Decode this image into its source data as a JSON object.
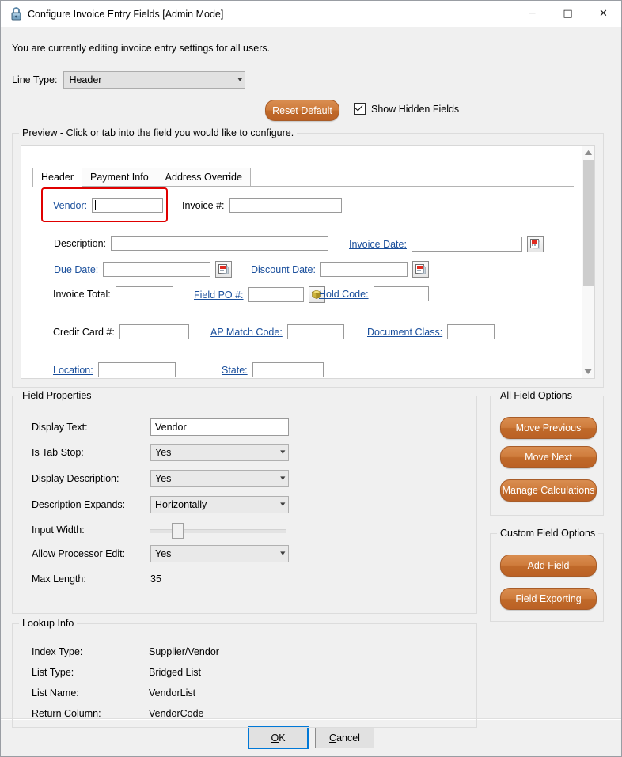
{
  "window": {
    "title": "Configure Invoice Entry Fields [Admin Mode]",
    "lock_icon": "lock-icon",
    "minimize": "─",
    "maximize": "□",
    "close": "✕"
  },
  "notice": "You are currently editing invoice entry settings for all users.",
  "toolbar": {
    "line_type_label": "Line Type:",
    "line_type_value": "Header",
    "reset_default_label": "Reset Default",
    "show_hidden_fields_label": "Show Hidden Fields",
    "show_hidden_fields_checked": true
  },
  "preview": {
    "legend": "Preview - Click or tab into the field you would like to configure.",
    "tabs": [
      {
        "label": "Header",
        "active": true
      },
      {
        "label": "Payment Info",
        "active": false
      },
      {
        "label": "Address Override",
        "active": false
      }
    ],
    "fields": [
      {
        "label": "Vendor:",
        "link": true,
        "selected": true
      },
      {
        "label": "Invoice #:",
        "link": false
      },
      {
        "label": "Description:",
        "link": false
      },
      {
        "label": "Invoice Date:",
        "link": true,
        "icon": "calendar-icon"
      },
      {
        "label": "Due Date:",
        "link": true,
        "icon": "calendar-icon"
      },
      {
        "label": "Discount Date:",
        "link": true,
        "icon": "calendar-icon"
      },
      {
        "label": "Invoice Total:",
        "link": false
      },
      {
        "label": "Field PO #:",
        "link": true,
        "icon": "cube-icon"
      },
      {
        "label": "Hold Code:",
        "link": true
      },
      {
        "label": "Credit Card #:",
        "link": false
      },
      {
        "label": "AP Match Code:",
        "link": true
      },
      {
        "label": "Document Class:",
        "link": true
      },
      {
        "label": "Location:",
        "link": true
      },
      {
        "label": "State:",
        "link": true
      }
    ]
  },
  "field_properties": {
    "legend": "Field Properties",
    "rows": [
      {
        "label": "Display Text:",
        "value": "Vendor",
        "type": "text"
      },
      {
        "label": "Is Tab Stop:",
        "value": "Yes",
        "type": "combo"
      },
      {
        "label": "Display Description:",
        "value": "Yes",
        "type": "combo"
      },
      {
        "label": "Description Expands:",
        "value": "Horizontally",
        "type": "combo"
      },
      {
        "label": "Input Width:",
        "value": "17",
        "type": "slider"
      },
      {
        "label": "Allow Processor Edit:",
        "value": "Yes",
        "type": "combo"
      },
      {
        "label": "Max Length:",
        "value": "35",
        "type": "static"
      }
    ]
  },
  "lookup_info": {
    "legend": "Lookup Info",
    "rows": [
      {
        "label": "Index Type:",
        "value": "Supplier/Vendor"
      },
      {
        "label": "List Type:",
        "value": "Bridged List"
      },
      {
        "label": "List Name:",
        "value": "VendorList"
      },
      {
        "label": "Return Column:",
        "value": "VendorCode"
      }
    ]
  },
  "all_field_options": {
    "legend": "All Field Options",
    "buttons": [
      "Move Previous",
      "Move Next",
      "Manage Calculations"
    ]
  },
  "custom_field_options": {
    "legend": "Custom Field Options",
    "buttons": [
      "Add Field",
      "Field Exporting"
    ]
  },
  "footer": {
    "ok_label": "OK",
    "cancel_label": "Cancel"
  },
  "colors": {
    "accent_orange": "#c06a2a",
    "link_blue": "#1a4f9c",
    "selection_red": "#e00000",
    "focus_blue": "#0078d7",
    "dialog_bg": "#f0f0f0"
  }
}
